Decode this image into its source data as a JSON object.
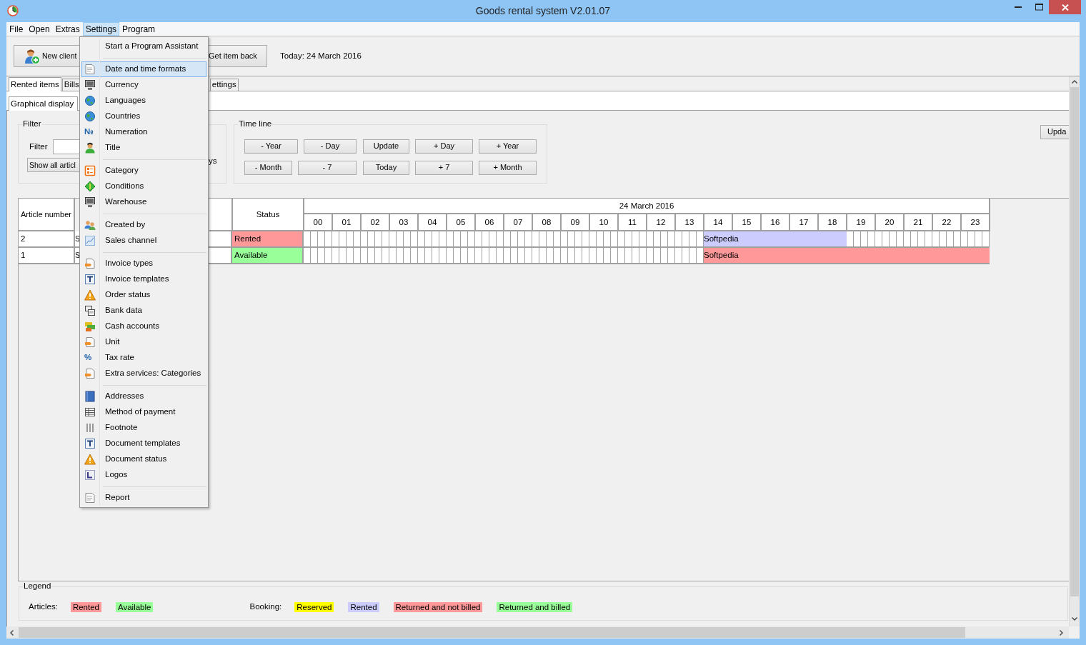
{
  "window": {
    "title": "Goods rental system V2.01.07"
  },
  "menu_bar": [
    {
      "label": "File",
      "selected": false
    },
    {
      "label": "Open",
      "selected": false
    },
    {
      "label": "Extras",
      "selected": false
    },
    {
      "label": "Settings",
      "selected": true
    },
    {
      "label": "Program",
      "selected": false
    }
  ],
  "settings_menu": {
    "groups": [
      [
        {
          "label": "Start a Program Assistant",
          "selected": false
        }
      ],
      [
        {
          "label": "Date and time formats",
          "selected": true
        },
        {
          "label": "Currency",
          "selected": false
        },
        {
          "label": "Languages",
          "selected": false
        },
        {
          "label": "Countries",
          "selected": false
        },
        {
          "label": "Numeration",
          "selected": false,
          "glyph": "№"
        },
        {
          "label": "Title",
          "selected": false
        }
      ],
      [
        {
          "label": "Category",
          "selected": false
        },
        {
          "label": "Conditions",
          "selected": false
        },
        {
          "label": "Warehouse",
          "selected": false
        }
      ],
      [
        {
          "label": "Created by",
          "selected": false
        },
        {
          "label": "Sales channel",
          "selected": false
        }
      ],
      [
        {
          "label": "Invoice types",
          "selected": false
        },
        {
          "label": "Invoice templates",
          "selected": false
        },
        {
          "label": "Order status",
          "selected": false
        },
        {
          "label": "Bank data",
          "selected": false
        },
        {
          "label": "Cash accounts",
          "selected": false
        },
        {
          "label": "Unit",
          "selected": false
        },
        {
          "label": "Tax rate",
          "selected": false,
          "glyph": "%"
        },
        {
          "label": "Extra services: Categories",
          "selected": false
        }
      ],
      [
        {
          "label": "Addresses",
          "selected": false
        },
        {
          "label": "Method of payment",
          "selected": false
        },
        {
          "label": "Footnote",
          "selected": false
        },
        {
          "label": "Document templates",
          "selected": false
        },
        {
          "label": "Document status",
          "selected": false
        },
        {
          "label": "Logos",
          "selected": false
        }
      ],
      [
        {
          "label": "Report",
          "selected": false
        }
      ]
    ]
  },
  "toolbar": {
    "new_client": "New client",
    "get_item_back": "Get item back",
    "today": "Today: 24 March 2016"
  },
  "tabs": [
    {
      "label": "Rented items",
      "selected": true
    },
    {
      "label": "Bills",
      "selected": false
    },
    {
      "label": "ettings",
      "selected": false
    }
  ],
  "subtabs": [
    {
      "label": "Graphical display",
      "selected": true
    }
  ],
  "filter": {
    "title": "Filter",
    "label": "Filter",
    "button": "Show all articl",
    "fragment": "ys"
  },
  "time_line": {
    "title": "Time line",
    "rows": [
      {
        "buttons": [
          "- Year",
          "- Day",
          "Update",
          "+ Day",
          "+ Year"
        ]
      },
      {
        "buttons": [
          "- Month",
          "- 7",
          "Today",
          "+ 7",
          "+ Month"
        ]
      }
    ]
  },
  "update_button": "Upda",
  "table": {
    "columns": [
      "Article number",
      "Status"
    ],
    "date_header": "24 March 2016",
    "hours": [
      "00",
      "01",
      "02",
      "03",
      "04",
      "05",
      "06",
      "07",
      "08",
      "09",
      "10",
      "11",
      "12",
      "13",
      "14",
      "15",
      "16",
      "17",
      "18",
      "19",
      "20",
      "21",
      "22",
      "23"
    ],
    "rows": [
      {
        "article_number": "2",
        "column_2": "S",
        "status": "Rented",
        "color": "#ff9999",
        "booking": {
          "label": "Softpedia",
          "color": "#ccccff"
        },
        "slots": [
          {
            "booked": false
          },
          {
            "booked": false
          },
          {
            "booked": false
          },
          {
            "booked": false
          },
          {
            "booked": false
          },
          {
            "booked": false
          },
          {
            "booked": false
          },
          {
            "booked": false
          },
          {
            "booked": false
          },
          {
            "booked": false
          },
          {
            "booked": false
          },
          {
            "booked": false
          },
          {
            "booked": false
          },
          {
            "booked": false
          },
          {
            "booked": true
          },
          {
            "booked": true
          },
          {
            "booked": true
          },
          {
            "booked": true
          },
          {
            "booked": true
          },
          {
            "booked": false
          },
          {
            "booked": false
          },
          {
            "booked": false
          },
          {
            "booked": false
          },
          {
            "booked": false
          }
        ]
      },
      {
        "article_number": "1",
        "column_2": "S",
        "status": "Available",
        "color": "#99ff99",
        "booking": {
          "label": "Softpedia",
          "color": "#ff9999"
        },
        "slots": [
          {
            "booked": false
          },
          {
            "booked": false
          },
          {
            "booked": false
          },
          {
            "booked": false
          },
          {
            "booked": false
          },
          {
            "booked": false
          },
          {
            "booked": false
          },
          {
            "booked": false
          },
          {
            "booked": false
          },
          {
            "booked": false
          },
          {
            "booked": false
          },
          {
            "booked": false
          },
          {
            "booked": false
          },
          {
            "booked": false
          },
          {
            "booked": true
          },
          {
            "booked": true
          },
          {
            "booked": true
          },
          {
            "booked": true
          },
          {
            "booked": true
          },
          {
            "booked": true
          },
          {
            "booked": true
          },
          {
            "booked": true
          },
          {
            "booked": true
          },
          {
            "booked": true
          }
        ]
      }
    ]
  },
  "legend": {
    "title": "Legend",
    "articles_label": "Articles:",
    "articles": [
      {
        "label": "Rented",
        "color": "#ff9999"
      },
      {
        "label": "Available",
        "color": "#99ff99"
      }
    ],
    "booking_label": "Booking:",
    "bookings": [
      {
        "label": "Reserved",
        "color": "#ffff00"
      },
      {
        "label": "Rented",
        "color": "#ccccff"
      },
      {
        "label": "Returned and not billed",
        "color": "#ff9999"
      },
      {
        "label": "Returned and billed",
        "color": "#99ff99"
      }
    ]
  }
}
